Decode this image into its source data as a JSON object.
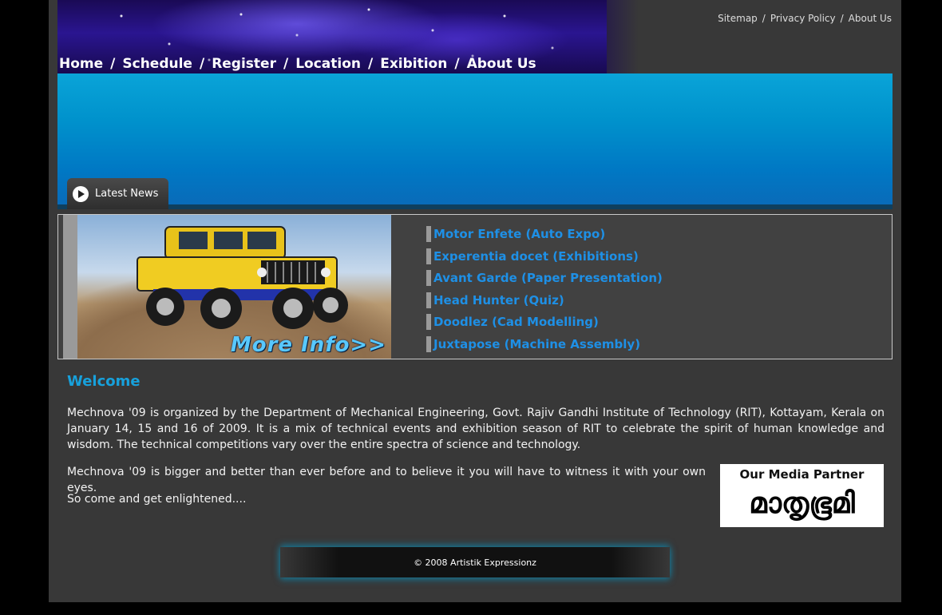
{
  "top_links": [
    "Sitemap",
    "Privacy Policy",
    "About Us"
  ],
  "nav": [
    "Home",
    "Schedule",
    "Register",
    "Location",
    "Exibition",
    "About Us"
  ],
  "news_tab": {
    "label": "Latest News"
  },
  "more_info": "More Info>>",
  "news_items": [
    "Motor Enfete (Auto Expo)",
    "Experentia docet (Exhibitions)",
    "Avant Garde (Paper Presentation)",
    "Head Hunter (Quiz)",
    "Doodlez (Cad Modelling)",
    "Juxtapose (Machine Assembly)"
  ],
  "welcome": {
    "title": "Welcome",
    "p1": "Mechnova '09 is organized by the Department of Mechanical Engineering, Govt. Rajiv Gandhi Institute of Technology (RIT), Kottayam, Kerala on January 14, 15 and 16 of 2009. It is a mix of technical events and exhibition season of RIT to celebrate the spirit of human knowledge and wisdom. The technical competitions vary over the entire spectra of science and technology.",
    "p2": "Mechnova '09 is bigger and better than ever before and to believe it you will have to witness it with your own eyes.",
    "p3": "So come and get enlightened...."
  },
  "partner": {
    "title": "Our Media Partner",
    "logo_text": "മാതൃഭൂമി"
  },
  "footer": "© 2008 Artistik Expressionz",
  "colors": {
    "accent": "#17a1dc",
    "link": "#1e90e6",
    "page_bg": "#383838"
  }
}
